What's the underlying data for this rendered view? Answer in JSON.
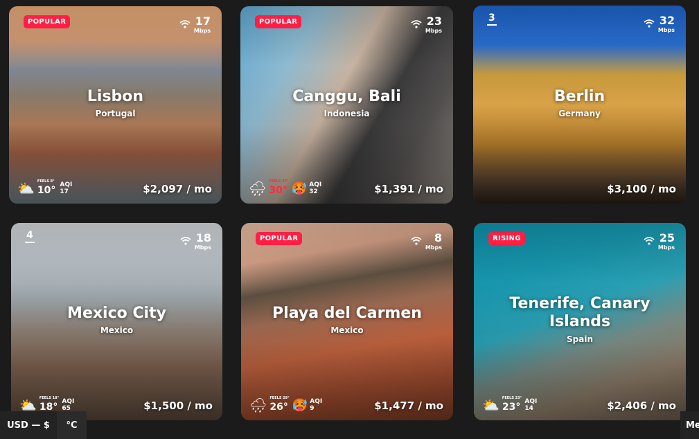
{
  "cards": [
    {
      "badge": "POPULAR",
      "rank": "",
      "city": "Lisbon",
      "country": "Portugal",
      "speed": "17",
      "speed_unit": "Mbps",
      "feels": "FEELS 8°",
      "temp": "10°",
      "aqi_label": "AQI",
      "aqi": "17",
      "price": "$2,097 / mo",
      "weather_icon": "partly-cloudy-icon",
      "aqi_icon": ""
    },
    {
      "badge": "POPULAR",
      "rank": "",
      "city": "Canggu, Bali",
      "country": "Indonesia",
      "speed": "23",
      "speed_unit": "Mbps",
      "feels": "FEELS 37°",
      "temp": "30°",
      "aqi_label": "AQI",
      "aqi": "32",
      "price": "$1,391 / mo",
      "weather_icon": "rain-cloud-icon",
      "aqi_icon": "hot-face-icon"
    },
    {
      "badge": "",
      "rank": "3",
      "city": "Berlin",
      "country": "Germany",
      "speed": "32",
      "speed_unit": "Mbps",
      "feels": "",
      "temp": "",
      "aqi_label": "",
      "aqi": "",
      "price": "$3,100 / mo",
      "weather_icon": "",
      "aqi_icon": ""
    },
    {
      "badge": "",
      "rank": "4",
      "city": "Mexico City",
      "country": "Mexico",
      "speed": "18",
      "speed_unit": "Mbps",
      "feels": "FEELS 18°",
      "temp": "18°",
      "aqi_label": "AQI",
      "aqi": "65",
      "price": "$1,500 / mo",
      "weather_icon": "partly-cloudy-icon",
      "aqi_icon": ""
    },
    {
      "badge": "POPULAR",
      "rank": "",
      "city": "Playa del Carmen",
      "country": "Mexico",
      "speed": "8",
      "speed_unit": "Mbps",
      "feels": "FEELS 29°",
      "temp": "26°",
      "aqi_label": "AQI",
      "aqi": "9",
      "price": "$1,477 / mo",
      "weather_icon": "rain-cloud-icon",
      "aqi_icon": "hot-face-icon"
    },
    {
      "badge": "RISING",
      "rank": "",
      "city": "Tenerife, Canary Islands",
      "country": "Spain",
      "speed": "25",
      "speed_unit": "Mbps",
      "feels": "FEELS 23°",
      "temp": "23°",
      "aqi_label": "AQI",
      "aqi": "14",
      "price": "$2,406 / mo",
      "weather_icon": "partly-cloudy-icon",
      "aqi_icon": ""
    }
  ],
  "footer": {
    "currency": "USD — $",
    "unit": "°C",
    "menu": "Me"
  },
  "colors": {
    "badge": "#ff1f44",
    "background": "#1b1b1b",
    "hot_temp": "#ff2a3c"
  }
}
